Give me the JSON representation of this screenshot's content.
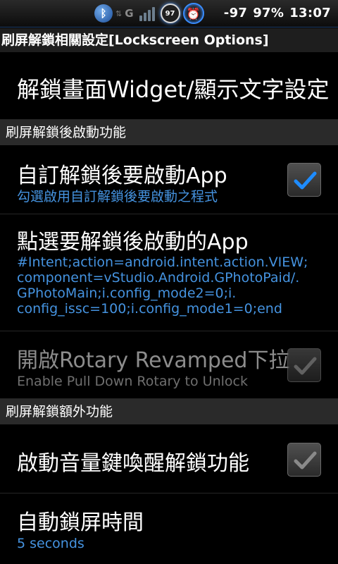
{
  "status_bar": {
    "bluetooth_icon": "bluetooth-icon",
    "sync_icon": "sync-arrows-icon",
    "network_type": "G",
    "battery_ring_value": "97",
    "signal_strength": "-97",
    "battery_percent": "97%",
    "time": "13:07"
  },
  "page_title": "刷屏解鎖相關設定[Lockscreen Options]",
  "items": {
    "widget_settings": {
      "title": "解鎖畫面Widget/顯示文字設定"
    },
    "section_launch": {
      "label": "刷屏解鎖後啟動功能"
    },
    "custom_launch": {
      "title": "自訂解鎖後要啟動App",
      "summary": "勾選啟用自訂解鎖後要啟動之程式",
      "checked": true
    },
    "select_app": {
      "title": "點選要解鎖後啟動的App",
      "summary_lines": [
        "#Intent;action=android.intent.action.VIEW;",
        "component=vStudio.Android.GPhotoPaid/.",
        "GPhotoMain;i.config_mode2=0;i.",
        "config_issc=100;i.config_mode1=0;end"
      ]
    },
    "rotary_pulldown": {
      "title": "開啟Rotary Revamped下拉",
      "summary": "Enable Pull Down Rotary to Unlock",
      "checked": true,
      "enabled": false
    },
    "section_extra": {
      "label": "刷屏解鎖額外功能"
    },
    "volume_wake": {
      "title": "啟動音量鍵喚醒解鎖功能",
      "checked": true
    },
    "auto_lock": {
      "title": "自動鎖屏時間",
      "summary": "5 seconds"
    }
  },
  "colors": {
    "accent_blue": "#4593e0",
    "check_blue": "#1e8cff",
    "check_gray": "#8a8a8a",
    "section_bg": "#2a2a2a"
  }
}
